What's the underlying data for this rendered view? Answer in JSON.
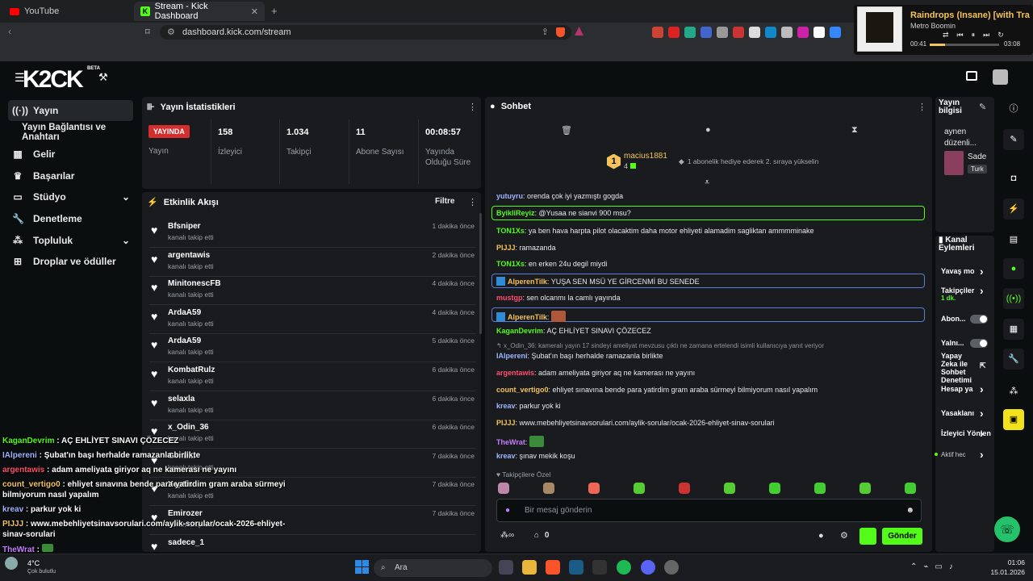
{
  "browser": {
    "tabs": [
      {
        "title": "YouTube"
      },
      {
        "title": "Stream - Kick Dashboard"
      }
    ],
    "url": "dashboard.kick.com/stream"
  },
  "media": {
    "title": "Raindrops (Insane) [with Tra",
    "artist": "Metro Boomin",
    "elapsed": "00:41",
    "total": "03:08",
    "progress": 0.22
  },
  "header": {
    "logo_text": "K2CK",
    "beta": "BETA"
  },
  "sidebar": {
    "items": [
      {
        "label": "Yayın",
        "icon": "broadcast-icon",
        "active": true
      },
      {
        "label": "Yayın Bağlantısı ve Anahtarı",
        "icon": ""
      },
      {
        "label": "Gelir",
        "icon": "grid-icon"
      },
      {
        "label": "Başarılar",
        "icon": "trophy-icon"
      },
      {
        "label": "Stüdyo",
        "icon": "studio-icon",
        "expandable": true
      },
      {
        "label": "Denetleme",
        "icon": "wrench-icon"
      },
      {
        "label": "Topluluk",
        "icon": "community-icon",
        "expandable": true
      },
      {
        "label": "Droplar ve ödüller",
        "icon": "drops-icon"
      }
    ]
  },
  "stats": {
    "title": "Yayın İstatistikleri",
    "live_badge": "YAYINDA",
    "live_label": "Yayın",
    "items": [
      {
        "value": "158",
        "label": "İzleyici"
      },
      {
        "value": "1.034",
        "label": "Takipçi"
      },
      {
        "value": "11",
        "label": "Abone Sayısı"
      },
      {
        "value": "00:08:57",
        "label": "Yayında Olduğu Süre"
      }
    ]
  },
  "activity": {
    "title": "Etkinlik Akışı",
    "filter": "Filtre",
    "items": [
      {
        "name": "Bfsniper",
        "action": "kanalı takip etti",
        "time": "1 dakika önce"
      },
      {
        "name": "argentawis",
        "action": "kanalı takip etti",
        "time": "2 dakika önce"
      },
      {
        "name": "MinitonescFB",
        "action": "kanalı takip etti",
        "time": "4 dakika önce"
      },
      {
        "name": "ArdaA59",
        "action": "kanalı takip etti",
        "time": "4 dakika önce"
      },
      {
        "name": "ArdaA59",
        "action": "kanalı takip etti",
        "time": "5 dakika önce"
      },
      {
        "name": "KombatRulz",
        "action": "kanalı takip etti",
        "time": "6 dakika önce"
      },
      {
        "name": "selaxla",
        "action": "kanalı takip etti",
        "time": "6 dakika önce"
      },
      {
        "name": "x_Odin_36",
        "action": "kanalı takip etti",
        "time": "6 dakika önce"
      },
      {
        "name": "Gentl...",
        "action": "kanalı takip etti",
        "time": "7 dakika önce"
      },
      {
        "name": "Xeptin",
        "action": "kanalı takip etti",
        "time": "7 dakika önce"
      },
      {
        "name": "Emirozer",
        "action": "kanalı takip etti",
        "time": "7 dakika önce"
      },
      {
        "name": "sadece_1",
        "action": "",
        "time": ""
      }
    ]
  },
  "chat": {
    "title": "Sohbet",
    "pinned_user": "macius1881",
    "pinned_level": "1",
    "pinned_count": "4",
    "pinned_text": "1 abonelik hediye ederek 2. sıraya yükselin",
    "reply_context": "x_Odin_36: kameralı yayın 17 sindeyi ameliyat mevzusu çıktı ne zamana ertelendi isimli kullanıcıya yanıt veriyor",
    "messages": [
      {
        "user": "yutuyru",
        "color": "#9fb5ff",
        "text": "orenda çok iyi yazmıştı gogda"
      },
      {
        "user": "ByikliReyiz",
        "color": "#53fc18",
        "text": "@Yusaa ne sianvi 900 msu?",
        "highlight": "#53fc18"
      },
      {
        "user": "TON1Xs",
        "color": "#53fc18",
        "text": "ya ben hava harpta pilot olacaktim daha motor ehliyeti alamadim sagliktan ammmminake"
      },
      {
        "user": "PIJJJ",
        "color": "#f4c35b",
        "text": "ramazanda"
      },
      {
        "user": "TON1Xs",
        "color": "#53fc18",
        "text": "en erken 24u degil miydi"
      },
      {
        "user": "AlperenTilk",
        "color": "#f4c35b",
        "text": "YUŞA SEN MSÜ YE GİRCENMİ BU SENEDE",
        "highlight": "#5a7bd6"
      },
      {
        "user": "mustgp",
        "color": "#ff4d6d",
        "text": "sen olcanmı la camlı yayında"
      },
      {
        "user": "AlperenTilk",
        "color": "#f4c35b",
        "text": "",
        "highlight": "#5a7bd6"
      },
      {
        "user": "KaganDevrim",
        "color": "#53fc18",
        "text": "AÇ EHLİYET SINAVI ÇÖZECEZ"
      },
      {
        "user": "IAlpereni",
        "color": "#9fb5ff",
        "text": "Şubat'ın başı herhalde ramazanla birlikte"
      },
      {
        "user": "argentawis",
        "color": "#ff4d6d",
        "text": "adam ameliyata giriyor aq ne kamerası ne yayını"
      },
      {
        "user": "count_vertigo0",
        "color": "#f4c35b",
        "text": "ehliyet sınavına bende para yatirdim gram araba sürmeyi bilmiyorum nasıl yapalım"
      },
      {
        "user": "kreav",
        "color": "#9fb5ff",
        "text": "parkur yok ki"
      },
      {
        "user": "PIJJJ",
        "color": "#f4c35b",
        "text": "www.mebehliyetsinavsorulari.com/aylik-sorular/ocak-2026-ehliyet-sinav-sorulari"
      },
      {
        "user": "TheWrat",
        "color": "#c77dff",
        "text": ""
      },
      {
        "user": "kreav",
        "color": "#9fb5ff",
        "text": "şınav mekik koşu"
      }
    ],
    "followers_only": "Takipçilere Özel",
    "input_placeholder": "Bir mesaj gönderin",
    "points": "0",
    "send": "Gönder"
  },
  "stream_info": {
    "title": "Yayın bilgisi",
    "stream_title": "aynen düzenli...",
    "category": "Sade",
    "tag": "Turk"
  },
  "channel_actions": {
    "title": "Kanal Eylemleri",
    "items": [
      {
        "label": "Yavaş mo",
        "type": "chevron"
      },
      {
        "label": "Takipçiler",
        "sub": "1 dk.",
        "type": "chevron"
      },
      {
        "label": "Abon...",
        "type": "toggle"
      },
      {
        "label": "Yalnı...",
        "type": "toggle"
      },
      {
        "label": "Yapay Zeka ile Sohbet Denetimi",
        "type": "external"
      },
      {
        "label": "Hesap ya",
        "type": "chevron"
      },
      {
        "label": "Yasaklanı",
        "type": "chevron"
      },
      {
        "label": "İzleyici Yönlen",
        "type": "chevron"
      },
      {
        "label": "Aktif hec",
        "type": "chevron"
      }
    ]
  },
  "overlay_chat": [
    {
      "user": "KaganDevrim",
      "color": "#53fc18",
      "text": "AÇ EHLİYET SINAVI ÇÖZECEZ"
    },
    {
      "user": "IAlpereni",
      "color": "#9fb5ff",
      "text": "Şubat'ın başı herhalde ramazanla birlikte"
    },
    {
      "user": "argentawis",
      "color": "#ff4d6d",
      "text": "adam ameliyata giriyor aq ne kamerası ne yayını"
    },
    {
      "user": "count_vertigo0",
      "color": "#f4c35b",
      "text": "ehliyet sınavına bende para yatirdim gram araba sürmeyi bilmiyorum nasıl yapalım"
    },
    {
      "user": "kreav",
      "color": "#9fb5ff",
      "text": "parkur yok ki"
    },
    {
      "user": "PIJJJ",
      "color": "#f4c35b",
      "text": "www.mebehliyetsinavsorulari.com/aylik-sorular/ocak-2026-ehliyet-sinav-sorulari"
    },
    {
      "user": "TheWrat",
      "color": "#c77dff",
      "text": ""
    },
    {
      "user": "kreav",
      "color": "#9fb5ff",
      "text": "şınav mekik koşu"
    }
  ],
  "taskbar": {
    "search": "Ara",
    "weather_temp": "4°C",
    "weather_desc": "Çok bulutlu",
    "time": "01:06",
    "date": "15.01.2026"
  },
  "colors": {
    "accent": "#53fc18",
    "live": "#d32f2f",
    "panel": "#191b1f",
    "background": "#0b0e0f"
  }
}
